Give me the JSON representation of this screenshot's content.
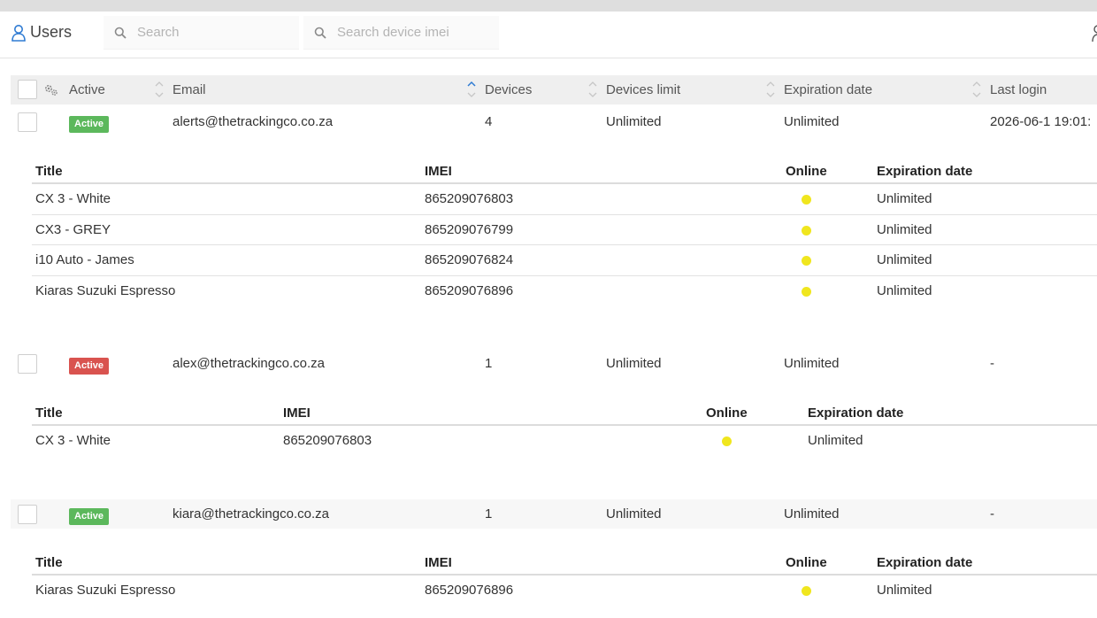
{
  "header": {
    "title": "Users",
    "search_placeholder": "Search",
    "imei_placeholder": "Search device imei"
  },
  "columns": {
    "active": "Active",
    "email": "Email",
    "devices": "Devices",
    "devices_limit": "Devices limit",
    "expiration": "Expiration date",
    "last_login": "Last login"
  },
  "device_columns": {
    "title": "Title",
    "imei": "IMEI",
    "online": "Online",
    "expiration": "Expiration date"
  },
  "users": [
    {
      "status": "Active",
      "status_color": "#5cb85c",
      "email": "alerts@thetrackingco.co.za",
      "devices": "4",
      "devices_limit": "Unlimited",
      "expiration": "Unlimited",
      "last_login": "2026-06-1   19:01:",
      "devices_list": [
        {
          "title": "CX 3 - White",
          "imei": "865209076803",
          "expiration": "Unlimited"
        },
        {
          "title": "CX3 - GREY",
          "imei": "865209076799",
          "expiration": "Unlimited"
        },
        {
          "title": "i10 Auto - James",
          "imei": "865209076824",
          "expiration": "Unlimited"
        },
        {
          "title": "Kiaras Suzuki Espresso",
          "imei": "865209076896",
          "expiration": "Unlimited"
        }
      ]
    },
    {
      "status": "Active",
      "status_color": "#d9534f",
      "email": "alex@thetrackingco.co.za",
      "devices": "1",
      "devices_limit": "Unlimited",
      "expiration": "Unlimited",
      "last_login": "-",
      "devices_list": [
        {
          "title": "CX 3 - White",
          "imei": "865209076803",
          "expiration": "Unlimited"
        }
      ]
    },
    {
      "status": "Active",
      "status_color": "#5cb85c",
      "email": "kiara@thetrackingco.co.za",
      "devices": "1",
      "devices_limit": "Unlimited",
      "expiration": "Unlimited",
      "last_login": "-",
      "devices_list": [
        {
          "title": "Kiaras Suzuki Espresso",
          "imei": "865209076896",
          "expiration": "Unlimited"
        }
      ]
    }
  ],
  "colors": {
    "online_dot": "#f0e61e",
    "accent": "#2f7bd3"
  }
}
